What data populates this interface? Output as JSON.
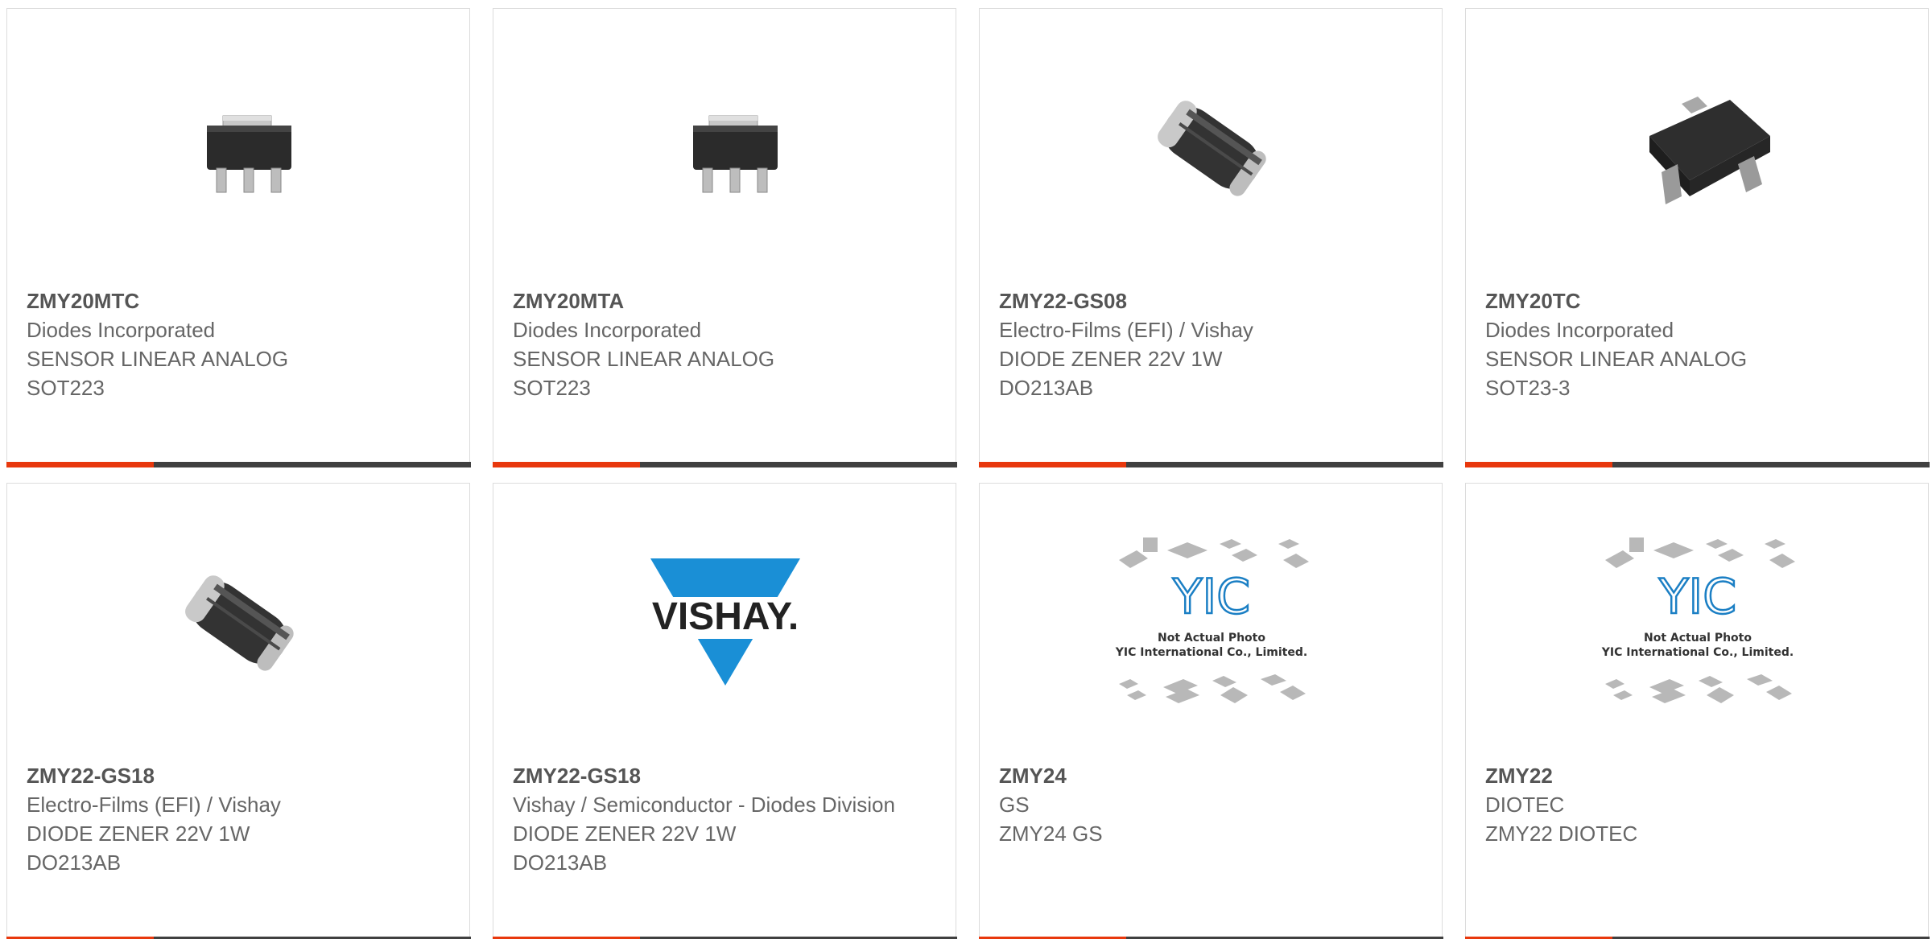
{
  "colors": {
    "accent": "#e8380d",
    "bar": "#404040",
    "border": "#dcdcdc",
    "part_number": "#555555",
    "text": "#666666",
    "vishay_blue": "#1a8fd6",
    "yic_blue": "#1b7fc4"
  },
  "products": [
    {
      "part_number": "ZMY20MTC",
      "manufacturer": "Diodes Incorporated",
      "description": "SENSOR LINEAR ANALOG",
      "package": "SOT223",
      "image_icon": "sot223-package-icon"
    },
    {
      "part_number": "ZMY20MTA",
      "manufacturer": "Diodes Incorporated",
      "description": "SENSOR LINEAR ANALOG",
      "package": "SOT223",
      "image_icon": "sot223-package-icon"
    },
    {
      "part_number": "ZMY22-GS08",
      "manufacturer": "Electro-Films (EFI) / Vishay",
      "description": "DIODE ZENER 22V 1W",
      "package": "DO213AB",
      "image_icon": "melf-diode-icon"
    },
    {
      "part_number": "ZMY20TC",
      "manufacturer": "Diodes Incorporated",
      "description": "SENSOR LINEAR ANALOG",
      "package": "SOT23-3",
      "image_icon": "sot23-package-icon"
    },
    {
      "part_number": "ZMY22-GS18",
      "manufacturer": "Electro-Films (EFI) / Vishay",
      "description": "DIODE ZENER 22V 1W",
      "package": "DO213AB",
      "image_icon": "melf-diode-icon"
    },
    {
      "part_number": "ZMY22-GS18",
      "manufacturer": "Vishay / Semiconductor - Diodes Division",
      "description": "DIODE ZENER 22V 1W",
      "package": "DO213AB",
      "image_icon": "vishay-logo-icon",
      "logo_text": "VISHAY."
    },
    {
      "part_number": "ZMY24",
      "manufacturer": "GS",
      "description": "ZMY24 GS",
      "image_icon": "yic-placeholder-icon",
      "placeholder_logo": "YIC",
      "placeholder_line1": "Not Actual Photo",
      "placeholder_line2": "YIC International Co., Limited."
    },
    {
      "part_number": "ZMY22",
      "manufacturer": "DIOTEC",
      "description": "ZMY22 DIOTEC",
      "image_icon": "yic-placeholder-icon",
      "placeholder_logo": "YIC",
      "placeholder_line1": "Not Actual Photo",
      "placeholder_line2": "YIC International Co., Limited."
    }
  ]
}
